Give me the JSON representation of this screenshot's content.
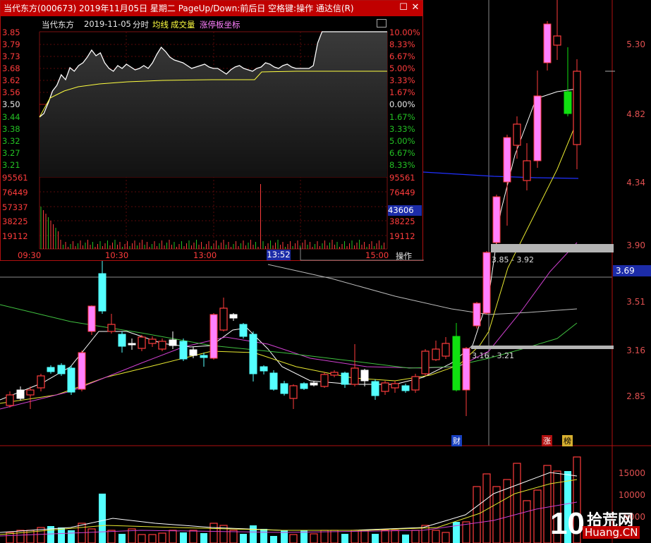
{
  "popup": {
    "title": "当代东方(000673) 2019年11月05日 星期二 PageUp/Down:前后日 空格键:操作 通达信(R)",
    "header": {
      "stock": "当代东方",
      "date": "2019-11-05",
      "mode": "分时",
      "avg_label": "均线",
      "vol_label": "成交量",
      "limit_label": "涨停板坐标"
    },
    "price_labels_left": [
      "3.85",
      "3.79",
      "3.73",
      "3.68",
      "3.62",
      "3.56",
      "3.50",
      "3.44",
      "3.38",
      "3.32",
      "3.27",
      "3.21"
    ],
    "pct_labels_right": [
      "10.00%",
      "8.33%",
      "6.67%",
      "5.00%",
      "3.33%",
      "1.67%",
      "0.00%",
      "1.67%",
      "3.33%",
      "5.00%",
      "6.67%",
      "8.33%"
    ],
    "vol_labels": [
      "95561",
      "76449",
      "57337",
      "38225",
      "19112"
    ],
    "time_labels": [
      "09:30",
      "10:30",
      "13:00",
      "15:00"
    ],
    "cursor_time": "13:52",
    "cursor_vol": "43606",
    "operate_label": "操作",
    "close_icon": "close-icon",
    "restore_icon": "restore-icon"
  },
  "main_chart": {
    "price_axis": [
      "5.30",
      "4.82",
      "4.34",
      "3.90",
      "3.51",
      "3.16",
      "2.85"
    ],
    "cursor_price": "3.69",
    "range_upper": "3.85 - 3.92",
    "range_lower": "3.16 - 3.21",
    "markers": {
      "cai": "财",
      "zhang": "涨",
      "bang": "榜"
    },
    "volume_axis": [
      "15000",
      "10000",
      "5000"
    ],
    "watermark_text": "拾荒网",
    "watermark_domain": "Huang.CN",
    "watermark_num": "10"
  },
  "colors": {
    "up": "#ff3c3c",
    "down": "#54ffff",
    "limit_up": "#ff80ff",
    "bg": "#000000"
  }
}
